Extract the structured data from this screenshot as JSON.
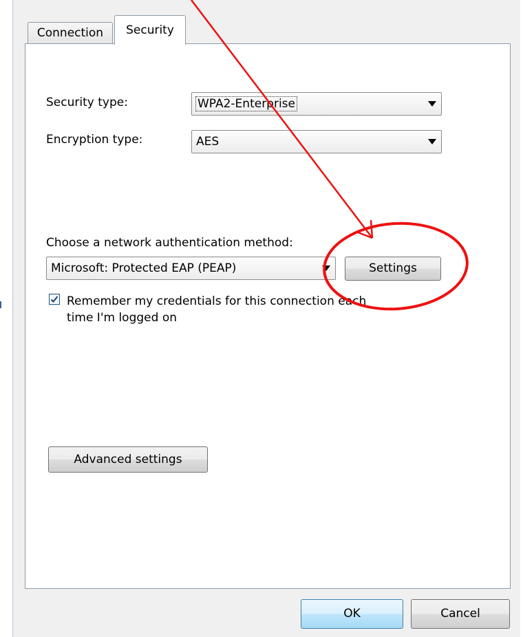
{
  "tabs": [
    {
      "label": "Connection"
    },
    {
      "label": "Security"
    }
  ],
  "security": {
    "security_type_label": "Security type:",
    "security_type_value": "WPA2-Enterprise",
    "encryption_type_label": "Encryption type:",
    "encryption_type_value": "AES",
    "auth_method_label": "Choose a network authentication method:",
    "auth_method_value": "Microsoft: Protected EAP (PEAP)",
    "settings_label": "Settings",
    "remember_line1": "Remember my credentials for this connection each",
    "remember_line2": "time I'm logged on",
    "remember_checked": true,
    "advanced_label": "Advanced settings"
  },
  "footer": {
    "ok_label": "OK",
    "cancel_label": "Cancel"
  },
  "annotation": {
    "color": "#ee1111"
  }
}
